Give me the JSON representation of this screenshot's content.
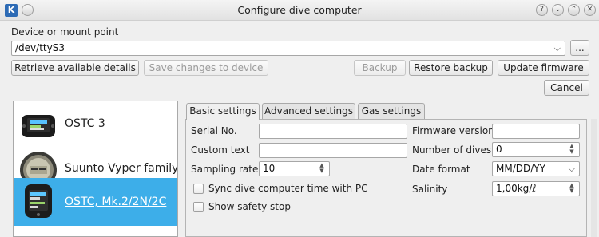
{
  "window": {
    "title": "Configure dive computer",
    "app_icon_glyph": "K",
    "buttons": {
      "help": "?",
      "shade": "⌄",
      "minimize": "⌃",
      "close": "✕"
    }
  },
  "device": {
    "label": "Device or mount point",
    "value": "/dev/ttyS3",
    "browse_label": "..."
  },
  "actions": {
    "retrieve": "Retrieve available details",
    "save": "Save changes to device",
    "backup": "Backup",
    "restore": "Restore backup",
    "update_firmware": "Update firmware",
    "cancel": "Cancel"
  },
  "devices": [
    {
      "name": "OSTC 3",
      "selected": false
    },
    {
      "name": "Suunto Vyper family",
      "selected": false
    },
    {
      "name": "OSTC, Mk.2/2N/2C",
      "selected": true
    }
  ],
  "tabs": [
    {
      "label": "Basic settings",
      "active": true
    },
    {
      "label": "Advanced settings",
      "active": false
    },
    {
      "label": "Gas settings",
      "active": false
    }
  ],
  "basic": {
    "serial_label": "Serial No.",
    "serial_value": "",
    "custom_text_label": "Custom text",
    "custom_text_value": "",
    "sampling_label": "Sampling rate",
    "sampling_value": "10",
    "sync_label": "Sync dive computer time with PC",
    "safety_label": "Show safety stop",
    "firmware_label": "Firmware version",
    "firmware_value": "",
    "dives_label": "Number of dives",
    "dives_value": "0",
    "date_format_label": "Date format",
    "date_format_value": "MM/DD/YY",
    "salinity_label": "Salinity",
    "salinity_value": "1,00kg/ℓ"
  },
  "colors": {
    "selection": "#3daee9",
    "window_bg": "#efefef"
  }
}
